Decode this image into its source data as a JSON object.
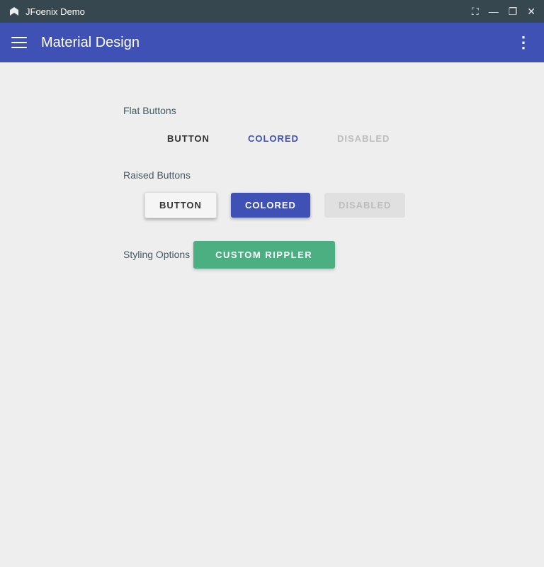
{
  "titlebar": {
    "app_name": "JFoenix Demo",
    "controls": {
      "maximize": "⛶",
      "minimize": "—",
      "restore": "❐",
      "close": "✕"
    }
  },
  "appbar": {
    "title": "Material Design",
    "menu_icon": "⋮"
  },
  "colors": {
    "titlebar_bg": "#37474f",
    "appbar_bg": "#3f51b5",
    "content_bg": "#eeeeee",
    "colored_btn": "#3f51b5",
    "custom_rippler_btn": "#4caf82"
  },
  "flat_buttons": {
    "section_label": "Flat Buttons",
    "button_label": "BUTTON",
    "colored_label": "COLORED",
    "disabled_label": "DISABLED"
  },
  "raised_buttons": {
    "section_label": "Raised Buttons",
    "button_label": "BUTTON",
    "colored_label": "COLORED",
    "disabled_label": "DISABLED"
  },
  "styling_options": {
    "section_label": "Styling Options",
    "custom_rippler_label": "CUSTOM RIPPLER"
  }
}
